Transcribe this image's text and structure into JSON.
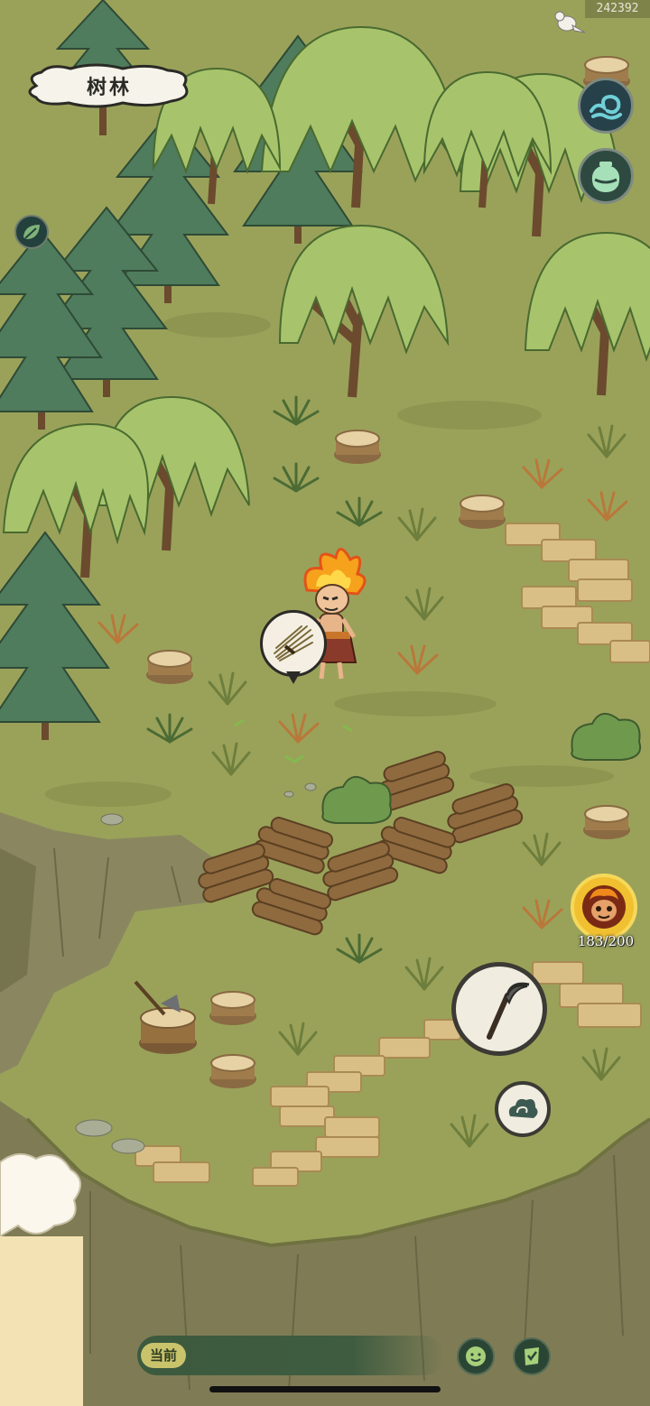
{
  "hud": {
    "player_id": "242392",
    "location_name": "树林",
    "companion_stamina": "183/200"
  },
  "chat": {
    "channel_tag": "当前"
  },
  "icons": {
    "water_button": "water-wave-icon",
    "jar_button": "jar-icon",
    "leaf_button": "leaf-icon",
    "resource": "straw-bundle-icon",
    "companion": "fire-monkey-portrait",
    "gather_tool": "sickle-icon",
    "cloud_button": "cloud-swirl-icon",
    "emoji_button": "smile-icon",
    "quest_button": "quest-checklist-icon"
  },
  "colors": {
    "grass": "#9aa25a",
    "cliff": "#7f7c55",
    "ink": "#2a2a26",
    "stamina_ring": "#f6d85a",
    "chat_bar": "#3c5a3e"
  }
}
